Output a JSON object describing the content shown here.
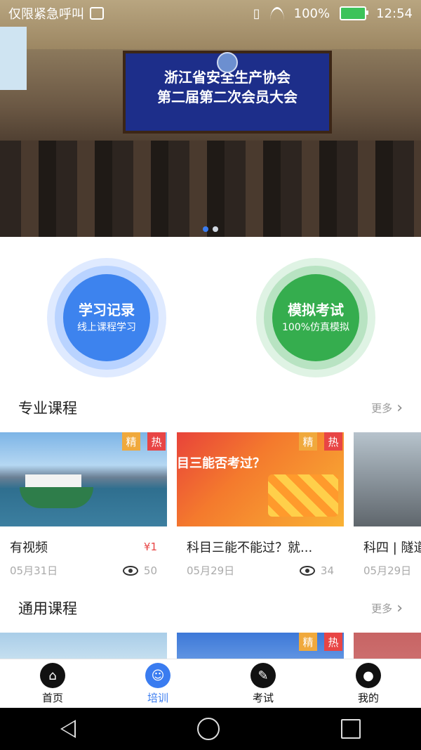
{
  "status": {
    "carrier": "仅限紧急呼叫",
    "battery": "100%",
    "time": "12:54"
  },
  "banner": {
    "line1": "浙江省安全生产协会",
    "line2": "第二届第二次会员大会",
    "slide_count": 2,
    "active_slide": 0
  },
  "quick": [
    {
      "title": "学习记录",
      "subtitle": "线上课程学习",
      "color": "#3d83ee"
    },
    {
      "title": "模拟考试",
      "subtitle": "100%仿真模拟",
      "color": "#35ad4e"
    }
  ],
  "pro_section": {
    "title": "专业课程",
    "more": "更多",
    "cards": [
      {
        "title": "有视频",
        "date": "05月31日",
        "price": "¥1",
        "views": "",
        "tag1": "精",
        "tag2": "热"
      },
      {
        "title": "科目三能不能过？就...",
        "date": "05月29日",
        "views": "34",
        "tag1": "精",
        "tag2": "热",
        "thumb_text": "目三能否考过？"
      },
      {
        "title": "科四 | 隧道",
        "date": "05月29日"
      }
    ],
    "first_views": "50"
  },
  "gen_section": {
    "title": "通用课程",
    "more": "更多",
    "tag1": "精",
    "tag2": "热"
  },
  "tabs": [
    {
      "label": "首页",
      "icon": "home-icon"
    },
    {
      "label": "培训",
      "icon": "training-icon",
      "active": true
    },
    {
      "label": "考试",
      "icon": "exam-icon"
    },
    {
      "label": "我的",
      "icon": "user-icon"
    }
  ]
}
